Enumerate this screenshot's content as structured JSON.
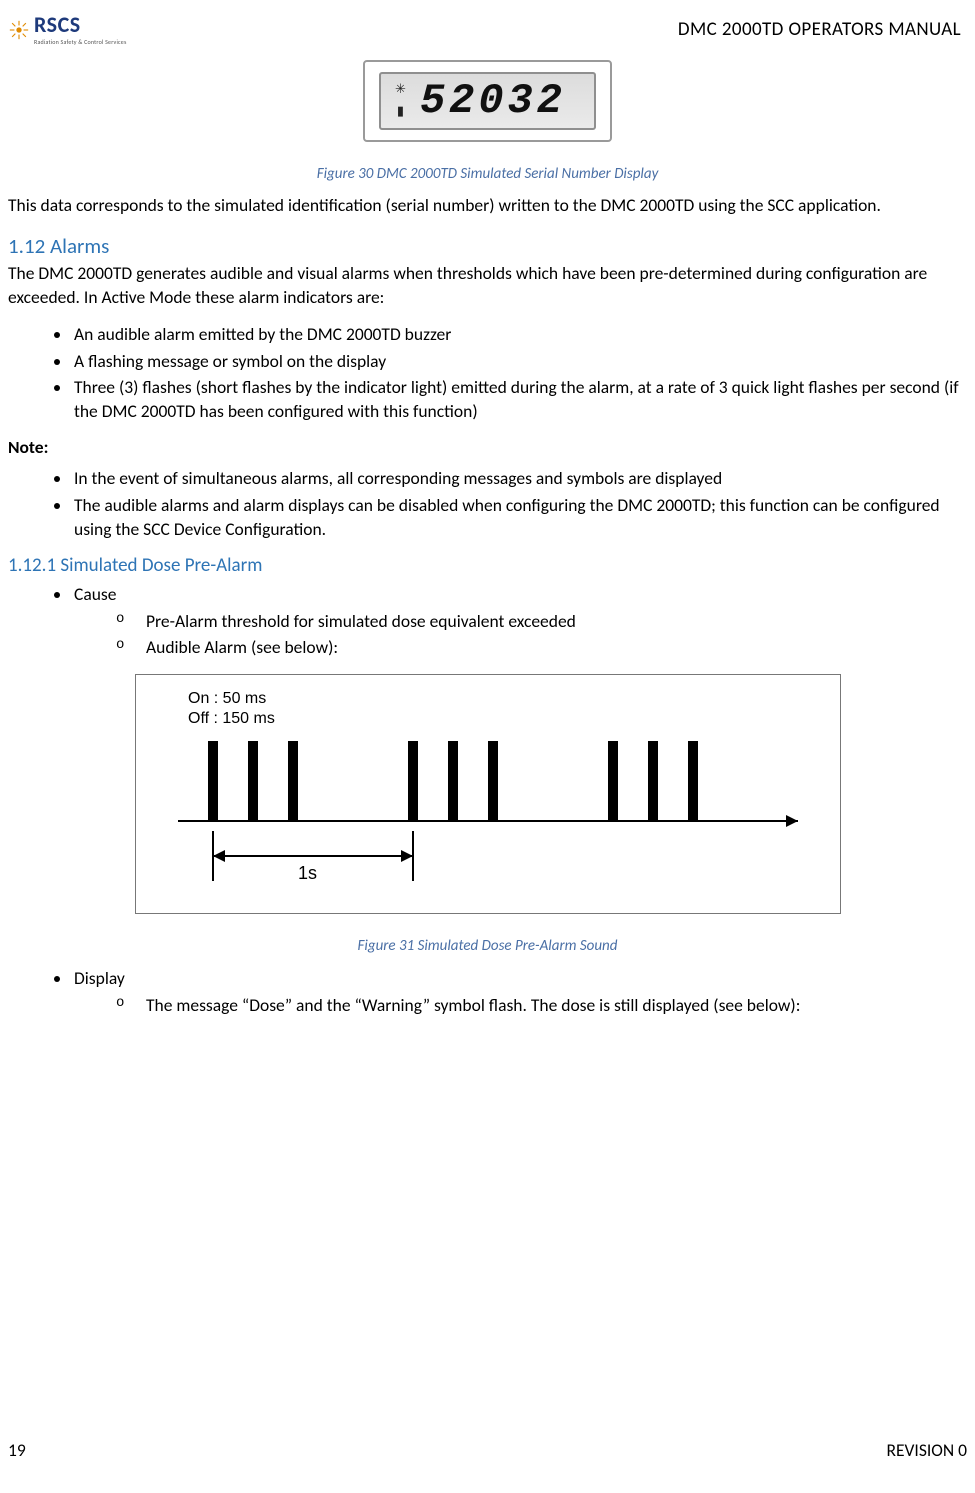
{
  "header": {
    "logo_text": "RSCS",
    "logo_sub": "Radiation Safety & Control Services",
    "doc_title": "DMC 2000TD OPERATORS MANUAL"
  },
  "lcd": {
    "digits": "52032"
  },
  "figure30_caption": "Figure 30 DMC 2000TD Simulated Serial Number Display",
  "para_intro": "This data corresponds to the simulated identification (serial number) written to the DMC 2000TD using the SCC application.",
  "sec112": {
    "heading": "1.12 Alarms",
    "intro": "The DMC 2000TD generates audible and visual alarms when thresholds which have been pre-determined during configuration are exceeded. In Active Mode these alarm indicators are:",
    "bullets": [
      "An audible alarm emitted by the DMC 2000TD buzzer",
      "A flashing message or symbol on the display",
      "Three (3) flashes (short flashes by the indicator light) emitted during the alarm, at a rate of 3 quick light flashes per second (if the DMC 2000TD has been configured with this function)"
    ],
    "note_label": "Note:",
    "note_bullets": [
      "In the event of simultaneous alarms, all corresponding messages and symbols are displayed",
      "The audible alarms and alarm displays can be disabled when configuring the DMC 2000TD; this function can be configured using the SCC Device Configuration."
    ]
  },
  "sec1121": {
    "heading": "1.12.1 Simulated Dose Pre-Alarm",
    "cause_label": "Cause",
    "cause_items": [
      "Pre-Alarm threshold for simulated dose equivalent exceeded",
      "Audible Alarm (see below):"
    ],
    "display_label": "Display",
    "display_items": [
      "The message “Dose” and the “Warning” symbol flash. The dose is still displayed (see below):"
    ]
  },
  "timing": {
    "on_label": "On :   50 ms",
    "off_label": "Off : 150 ms",
    "interval_label": "1s"
  },
  "figure31_caption": "Figure 31 Simulated Dose Pre-Alarm Sound",
  "footer": {
    "page": "19",
    "revision": "REVISION 0"
  },
  "chart_data": {
    "type": "bar",
    "description": "Pulse timing diagram: three bursts of three short pulses each, 1 s between burst starts",
    "pulse_on_ms": 50,
    "pulse_off_ms": 150,
    "pulses_per_burst": 3,
    "burst_interval_s": 1,
    "bursts_shown": 3
  }
}
